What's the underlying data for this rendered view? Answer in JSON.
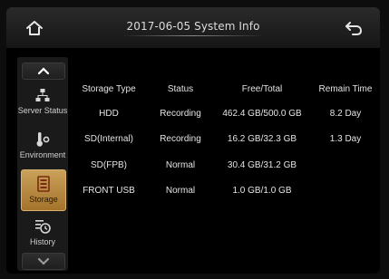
{
  "header": {
    "title": "2017-06-05  System Info",
    "home_icon": "home-icon",
    "back_icon": "back-arrow-icon"
  },
  "sidebar": {
    "up_icon": "chevron-up-icon",
    "down_icon": "chevron-down-icon",
    "items": [
      {
        "label": "Server Status",
        "icon": "network-icon",
        "active": false
      },
      {
        "label": "Environment",
        "icon": "thermometer-icon",
        "active": false
      },
      {
        "label": "Storage",
        "icon": "storage-icon",
        "active": true
      },
      {
        "label": "History",
        "icon": "history-icon",
        "active": false
      }
    ]
  },
  "table": {
    "headers": [
      "Storage Type",
      "Status",
      "Free/Total",
      "Remain Time"
    ],
    "rows": [
      [
        "HDD",
        "Recording",
        "462.4 GB/500.0 GB",
        "8.2 Day"
      ],
      [
        "SD(Internal)",
        "Recording",
        "16.2 GB/32.3 GB",
        "1.3 Day"
      ],
      [
        "SD(FPB)",
        "Normal",
        "30.4 GB/31.2 GB",
        ""
      ],
      [
        "FRONT USB",
        "Normal",
        "1.0 GB/1.0 GB",
        ""
      ]
    ]
  },
  "colors": {
    "active_tab": "#b8893f",
    "background": "#000000",
    "text": "#e4e4e4"
  }
}
